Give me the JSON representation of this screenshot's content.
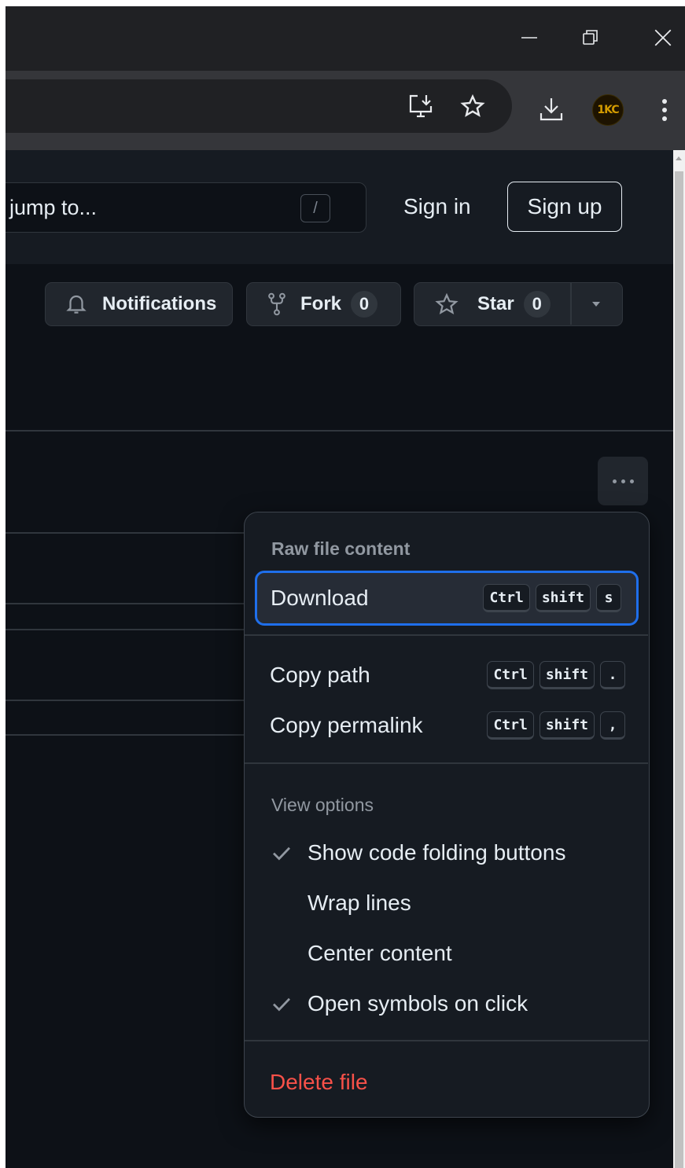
{
  "window": {
    "minimize_icon": "minimize-icon",
    "restore_icon": "restore-icon",
    "close_icon": "close-icon"
  },
  "browser": {
    "install_app_icon": "install-app-icon",
    "bookmark_icon": "star-icon",
    "downloads_icon": "download-icon",
    "profile_initials": "1KC",
    "menu_icon": "kebab-menu-icon"
  },
  "header": {
    "search_placeholder": "jump to...",
    "search_shortcut": "/",
    "sign_in": "Sign in",
    "sign_up": "Sign up"
  },
  "repo_actions": {
    "notifications_label": "Notifications",
    "fork_label": "Fork",
    "fork_count": "0",
    "star_label": "Star",
    "star_count": "0"
  },
  "menu": {
    "raw_heading": "Raw file content",
    "download": {
      "label": "Download",
      "keys": [
        "Ctrl",
        "shift",
        "s"
      ]
    },
    "copy_path": {
      "label": "Copy path",
      "keys": [
        "Ctrl",
        "shift",
        "."
      ]
    },
    "copy_permalink": {
      "label": "Copy permalink",
      "keys": [
        "Ctrl",
        "shift",
        ","
      ]
    },
    "view_heading": "View options",
    "view_options": [
      {
        "label": "Show code folding buttons",
        "checked": true
      },
      {
        "label": "Wrap lines",
        "checked": false
      },
      {
        "label": "Center content",
        "checked": false
      },
      {
        "label": "Open symbols on click",
        "checked": true
      }
    ],
    "delete": {
      "label": "Delete file",
      "color": "#f85149"
    }
  },
  "colors": {
    "page_bg": "#0d1117",
    "header_bg": "#161b22",
    "focus_ring": "#1f6feb",
    "danger": "#f85149"
  }
}
